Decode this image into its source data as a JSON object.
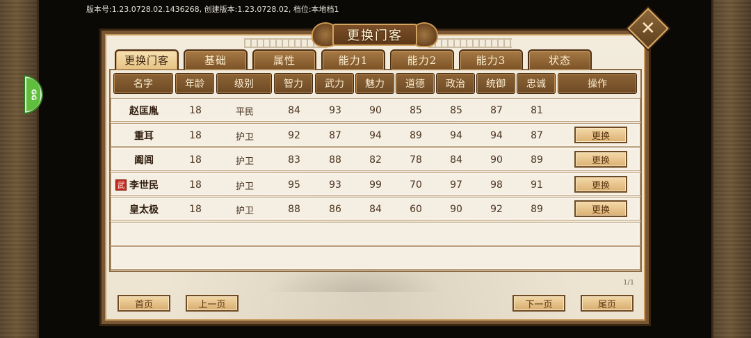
{
  "version_text": "版本号:1.23.0728.02.1436268, 创建版本:1.23.0728.02, 档位:本地档1",
  "float_button": {
    "label": "GG"
  },
  "dialog": {
    "title": "更换门客",
    "close_glyph": "✕"
  },
  "tabs": [
    {
      "label": "更换门客",
      "active": true
    },
    {
      "label": "基础",
      "active": false
    },
    {
      "label": "属性",
      "active": false
    },
    {
      "label": "能力1",
      "active": false
    },
    {
      "label": "能力2",
      "active": false
    },
    {
      "label": "能力3",
      "active": false
    },
    {
      "label": "状态",
      "active": false
    }
  ],
  "table": {
    "headers": [
      "名字",
      "年龄",
      "级别",
      "智力",
      "武力",
      "魅力",
      "道德",
      "政治",
      "统御",
      "忠诚",
      "操作"
    ],
    "rows": [
      {
        "name": "赵匡胤",
        "age": "18",
        "level": "平民",
        "int": "84",
        "str": "93",
        "cha": "90",
        "mor": "85",
        "pol": "85",
        "lead": "87",
        "loy": "81",
        "action": "",
        "badge": ""
      },
      {
        "name": "重耳",
        "age": "18",
        "level": "护卫",
        "int": "92",
        "str": "87",
        "cha": "94",
        "mor": "89",
        "pol": "94",
        "lead": "94",
        "loy": "87",
        "action": "更换",
        "badge": ""
      },
      {
        "name": "阖闾",
        "age": "18",
        "level": "护卫",
        "int": "83",
        "str": "88",
        "cha": "82",
        "mor": "78",
        "pol": "84",
        "lead": "90",
        "loy": "89",
        "action": "更换",
        "badge": ""
      },
      {
        "name": "李世民",
        "age": "18",
        "level": "护卫",
        "int": "95",
        "str": "93",
        "cha": "99",
        "mor": "70",
        "pol": "97",
        "lead": "98",
        "loy": "91",
        "action": "更换",
        "badge": "武"
      },
      {
        "name": "皇太极",
        "age": "18",
        "level": "护卫",
        "int": "88",
        "str": "86",
        "cha": "84",
        "mor": "60",
        "pol": "90",
        "lead": "92",
        "loy": "89",
        "action": "更换",
        "badge": ""
      }
    ]
  },
  "pager": {
    "page_info": "1/1",
    "first": "首页",
    "prev": "上一页",
    "next": "下一页",
    "last": "尾页"
  },
  "colors": {
    "panel_bg": "#efe7d6",
    "header_brown": "#7b532b",
    "active_tab": "#f0d49c",
    "badge_red": "#c4281d"
  }
}
